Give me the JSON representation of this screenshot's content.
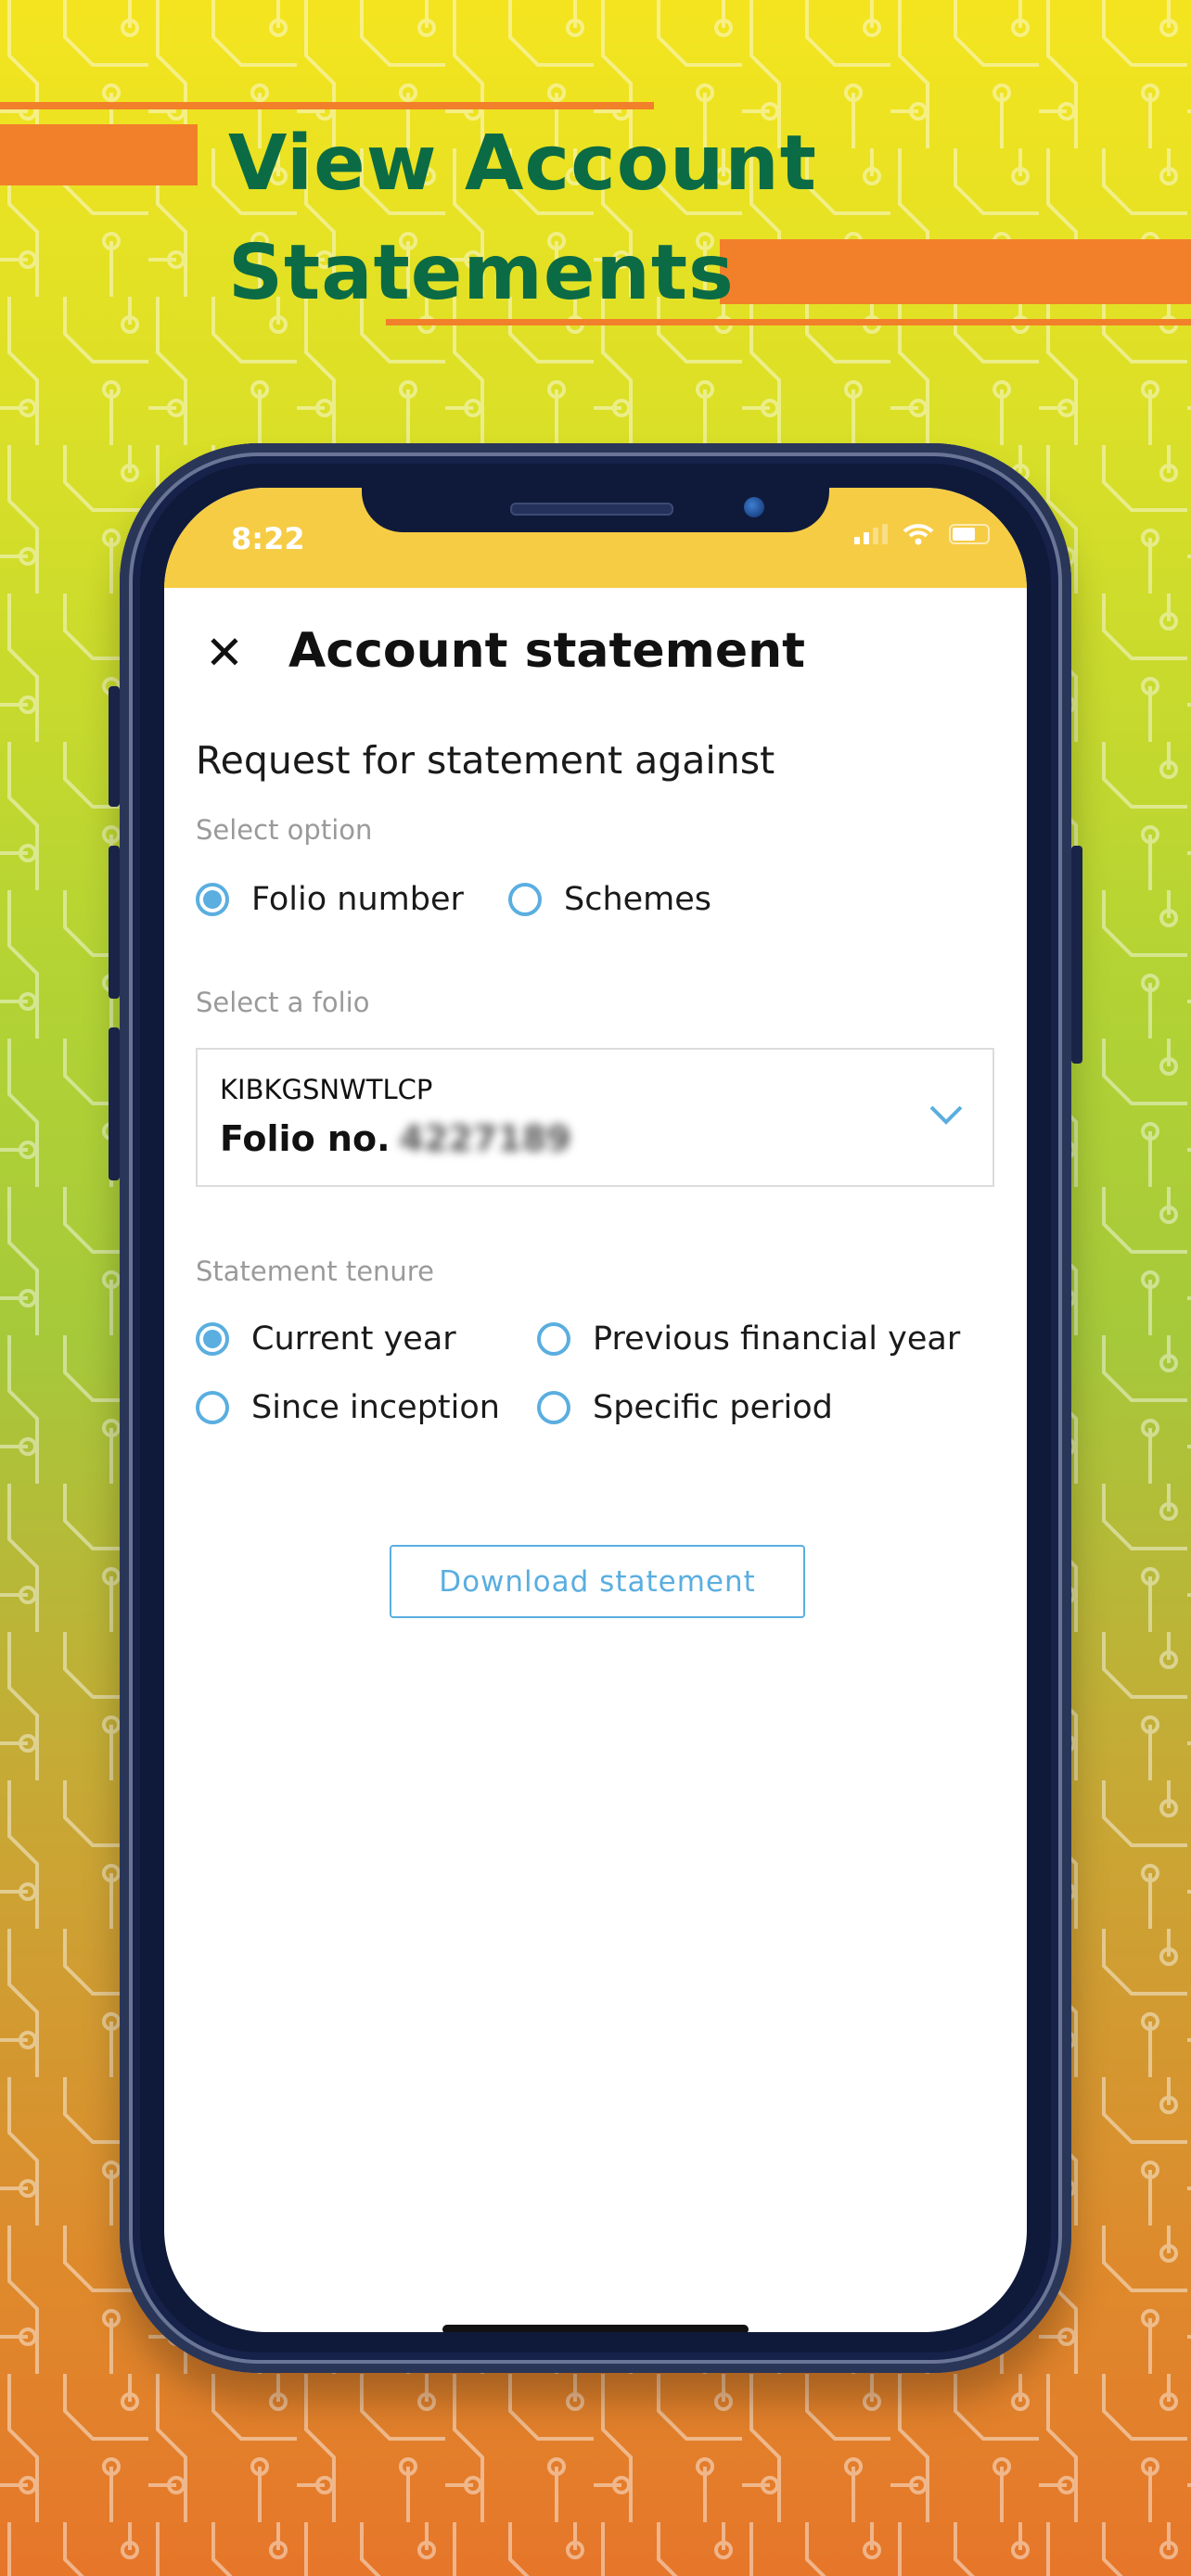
{
  "promo": {
    "headline_line1": "View Account",
    "headline_line2": "Statements"
  },
  "colors": {
    "headline": "#0b6b45",
    "accent_bar": "#f2802a",
    "status_bar": "#f6cc45",
    "primary": "#5aaee0"
  },
  "status_bar": {
    "time": "8:22",
    "icons": [
      "signal-icon",
      "wifi-icon",
      "battery-icon"
    ]
  },
  "header": {
    "close_icon": "close-icon",
    "title": "Account statement"
  },
  "form": {
    "heading": "Request for statement against",
    "select_option_label": "Select option",
    "options": [
      {
        "label": "Folio number",
        "selected": true
      },
      {
        "label": "Schemes",
        "selected": false
      }
    ],
    "select_folio_label": "Select a folio",
    "folio": {
      "code": "KIBKGSNWTLCP",
      "prefix": "Folio no.",
      "number_blurred": "4227189"
    },
    "tenure_label": "Statement tenure",
    "tenure_options": [
      {
        "label": "Current year",
        "selected": true
      },
      {
        "label": "Previous financial year",
        "selected": false
      },
      {
        "label": "Since inception",
        "selected": false
      },
      {
        "label": "Specific period",
        "selected": false
      }
    ],
    "download_label": "Download statement"
  }
}
